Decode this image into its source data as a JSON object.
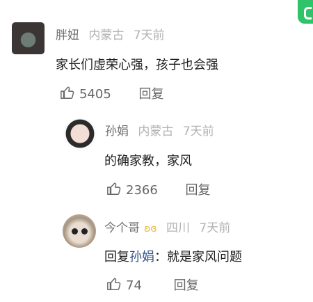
{
  "comments": [
    {
      "user": "胖妞",
      "region": "内蒙古",
      "time": "7天前",
      "text": "家长们虚荣心强，孩子也会强",
      "likes": "5405",
      "reply_label": "回复",
      "avatar_icon": "user-avatar"
    },
    {
      "user": "孙娟",
      "region": "内蒙古",
      "time": "7天前",
      "text": "的确家教，家风",
      "likes": "2366",
      "reply_label": "回复",
      "avatar_icon": "user-avatar"
    },
    {
      "user": "今个哥",
      "badge": "butterfly-badge-icon",
      "region": "四川",
      "time": "7天前",
      "text_prefix": "回复",
      "text_ref": "孙娟",
      "text_rest": "：就是家风问题",
      "likes": "74",
      "reply_label": "回复",
      "avatar_icon": "cat-avatar"
    }
  ],
  "colors": {
    "accent": "#2fc36a",
    "link": "#2f4f85",
    "muted": "#b3b3b3"
  }
}
